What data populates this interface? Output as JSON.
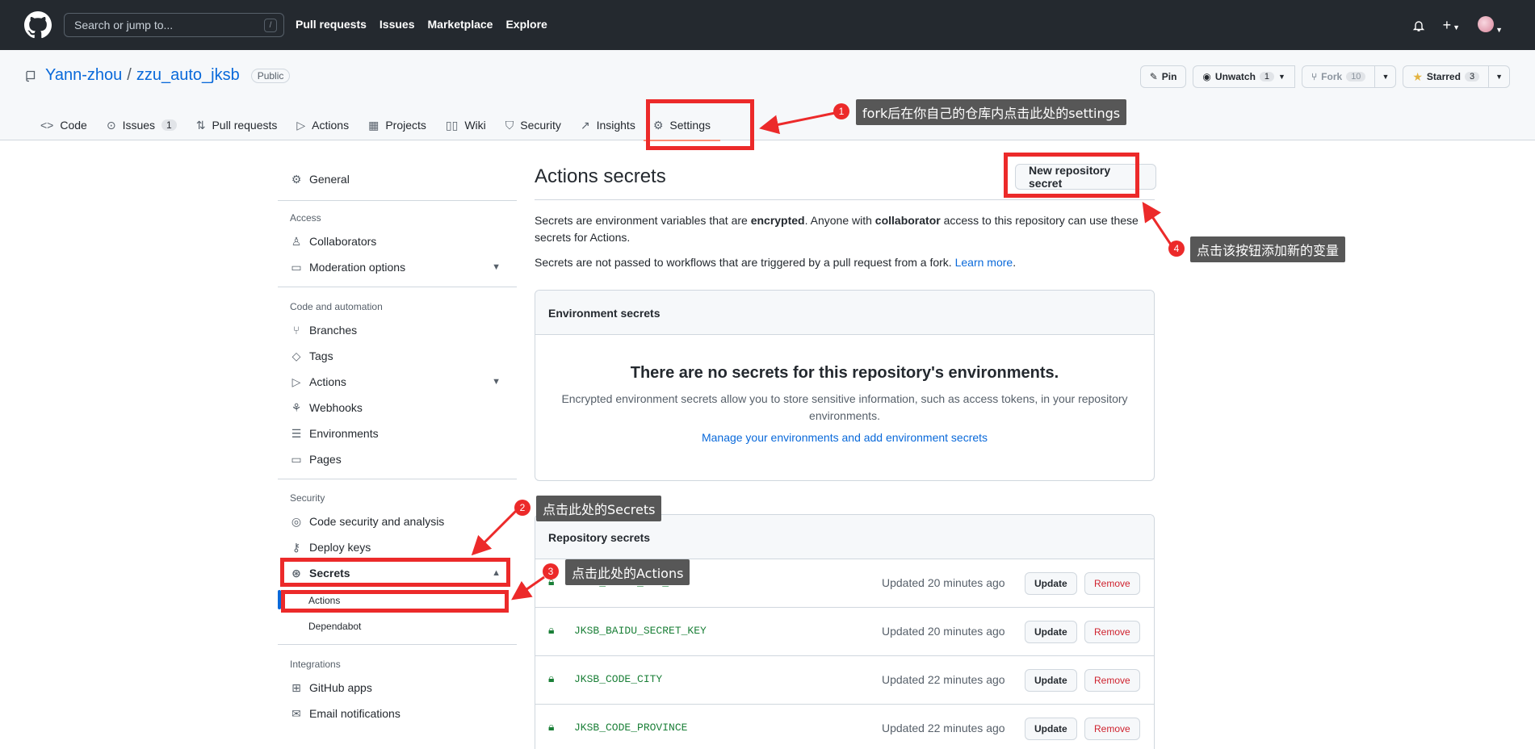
{
  "header": {
    "search_placeholder": "Search or jump to...",
    "search_shortcut": "/",
    "nav": [
      "Pull requests",
      "Issues",
      "Marketplace",
      "Explore"
    ]
  },
  "repo": {
    "owner": "Yann-zhou",
    "separator": "/",
    "name": "zzu_auto_jksb",
    "visibility": "Public",
    "pin_label": "Pin",
    "unwatch_label": "Unwatch",
    "unwatch_count": "1",
    "fork_label": "Fork",
    "fork_count": "10",
    "starred_label": "Starred",
    "starred_count": "3",
    "tabs": [
      {
        "label": "Code",
        "icon": "code-icon"
      },
      {
        "label": "Issues",
        "icon": "issue-icon",
        "count": "1"
      },
      {
        "label": "Pull requests",
        "icon": "pull-request-icon"
      },
      {
        "label": "Actions",
        "icon": "play-icon"
      },
      {
        "label": "Projects",
        "icon": "table-icon"
      },
      {
        "label": "Wiki",
        "icon": "book-icon"
      },
      {
        "label": "Security",
        "icon": "shield-icon"
      },
      {
        "label": "Insights",
        "icon": "graph-icon"
      },
      {
        "label": "Settings",
        "icon": "gear-icon"
      }
    ]
  },
  "sidebar": {
    "general": "General",
    "access_heading": "Access",
    "collaborators": "Collaborators",
    "moderation": "Moderation options",
    "code_heading": "Code and automation",
    "branches": "Branches",
    "tags": "Tags",
    "actions": "Actions",
    "webhooks": "Webhooks",
    "environments": "Environments",
    "pages": "Pages",
    "security_heading": "Security",
    "code_security": "Code security and analysis",
    "deploy_keys": "Deploy keys",
    "secrets": "Secrets",
    "secrets_actions": "Actions",
    "secrets_dependabot": "Dependabot",
    "integrations_heading": "Integrations",
    "github_apps": "GitHub apps",
    "email_notifications": "Email notifications"
  },
  "main": {
    "title": "Actions secrets",
    "new_button": "New repository secret",
    "desc_1a": "Secrets are environment variables that are ",
    "desc_1b": "encrypted",
    "desc_1c": ". Anyone with ",
    "desc_1d": "collaborator",
    "desc_1e": " access to this repository can use these secrets for Actions.",
    "desc_2": "Secrets are not passed to workflows that are triggered by a pull request from a fork. ",
    "learn_more": "Learn more",
    "env_heading": "Environment secrets",
    "env_empty_title": "There are no secrets for this repository's environments.",
    "env_empty_desc": "Encrypted environment secrets allow you to store sensitive information, such as access tokens, in your repository environments.",
    "env_link": "Manage your environments and add environment secrets",
    "repo_heading": "Repository secrets",
    "update_label": "Update",
    "remove_label": "Remove",
    "secrets": [
      {
        "name": "JKSB_BAIDU_API_KEY",
        "updated": "Updated 20 minutes ago"
      },
      {
        "name": "JKSB_BAIDU_SECRET_KEY",
        "updated": "Updated 20 minutes ago"
      },
      {
        "name": "JKSB_CODE_CITY",
        "updated": "Updated 22 minutes ago"
      },
      {
        "name": "JKSB_CODE_PROVINCE",
        "updated": "Updated 22 minutes ago"
      }
    ]
  },
  "annotations": {
    "n1": "1",
    "t1": "fork后在你自己的仓库内点击此处的settings",
    "n2": "2",
    "t2": "点击此处的Secrets",
    "n3": "3",
    "t3": "点击此处的Actions",
    "n4": "4",
    "t4": "点击该按钮添加新的变量",
    "color": "#ec2a2a"
  }
}
